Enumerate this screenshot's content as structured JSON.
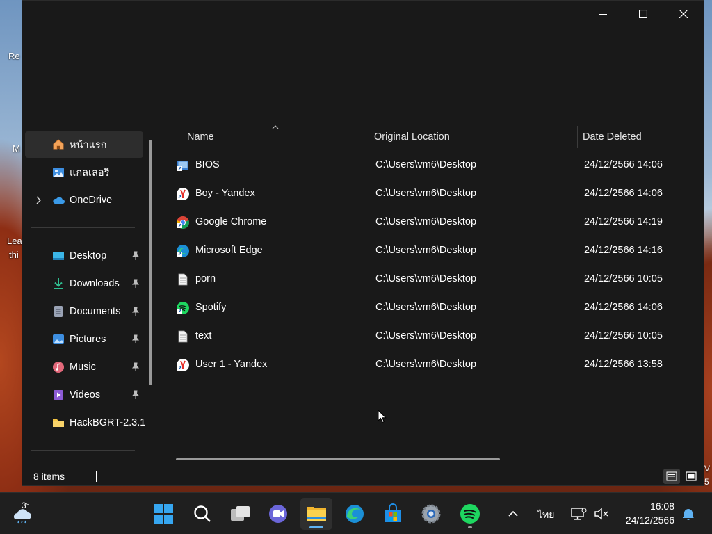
{
  "desktop": {
    "icon_labels": [
      "Re",
      "M",
      "Lea",
      "thi"
    ],
    "right_edge_text": [
      "V",
      "5"
    ]
  },
  "window": {
    "nav": {
      "items": [
        {
          "label": "หน้าแรก",
          "icon": "home-icon"
        },
        {
          "label": "แกลเลอรี",
          "icon": "gallery-icon"
        },
        {
          "label": "OneDrive",
          "icon": "onedrive-icon"
        },
        {
          "label": "Desktop",
          "icon": "desktop-folder-icon"
        },
        {
          "label": "Downloads",
          "icon": "downloads-folder-icon"
        },
        {
          "label": "Documents",
          "icon": "documents-folder-icon"
        },
        {
          "label": "Pictures",
          "icon": "pictures-folder-icon"
        },
        {
          "label": "Music",
          "icon": "music-folder-icon"
        },
        {
          "label": "Videos",
          "icon": "videos-folder-icon"
        },
        {
          "label": "HackBGRT-2.3.1",
          "icon": "folder-icon"
        }
      ]
    },
    "columns": {
      "name": "Name",
      "original_location": "Original Location",
      "date_deleted": "Date Deleted"
    },
    "rows": [
      {
        "name": "BIOS",
        "location": "C:\\Users\\vm6\\Desktop",
        "date": "24/12/2566 14:06",
        "icon": "shortcut-icon"
      },
      {
        "name": "Boy - Yandex",
        "location": "C:\\Users\\vm6\\Desktop",
        "date": "24/12/2566 14:06",
        "icon": "yandex-shortcut-icon"
      },
      {
        "name": "Google Chrome",
        "location": "C:\\Users\\vm6\\Desktop",
        "date": "24/12/2566 14:19",
        "icon": "chrome-icon"
      },
      {
        "name": "Microsoft Edge",
        "location": "C:\\Users\\vm6\\Desktop",
        "date": "24/12/2566 14:16",
        "icon": "edge-icon"
      },
      {
        "name": "porn",
        "location": "C:\\Users\\vm6\\Desktop",
        "date": "24/12/2566 10:05",
        "icon": "text-file-icon"
      },
      {
        "name": "Spotify",
        "location": "C:\\Users\\vm6\\Desktop",
        "date": "24/12/2566 14:06",
        "icon": "spotify-icon"
      },
      {
        "name": "text",
        "location": "C:\\Users\\vm6\\Desktop",
        "date": "24/12/2566 10:05",
        "icon": "text-file-icon"
      },
      {
        "name": "User 1 - Yandex",
        "location": "C:\\Users\\vm6\\Desktop",
        "date": "24/12/2566 13:58",
        "icon": "yandex-shortcut-icon"
      }
    ],
    "status": {
      "item_count": "8 items"
    }
  },
  "taskbar": {
    "weather_temp": "3°",
    "apps": [
      "start-icon",
      "search-icon",
      "task-view-icon",
      "chat-icon",
      "file-explorer-icon",
      "edge-icon",
      "store-icon",
      "settings-icon",
      "spotify-icon"
    ],
    "tray": {
      "language": "ไทย",
      "time": "16:08",
      "date": "24/12/2566"
    }
  },
  "colors": {
    "window_bg": "#191919",
    "selected_nav": "#2d2d2d",
    "taskbar_bg": "#1f1f1f",
    "accent": "#5fb2f2"
  }
}
